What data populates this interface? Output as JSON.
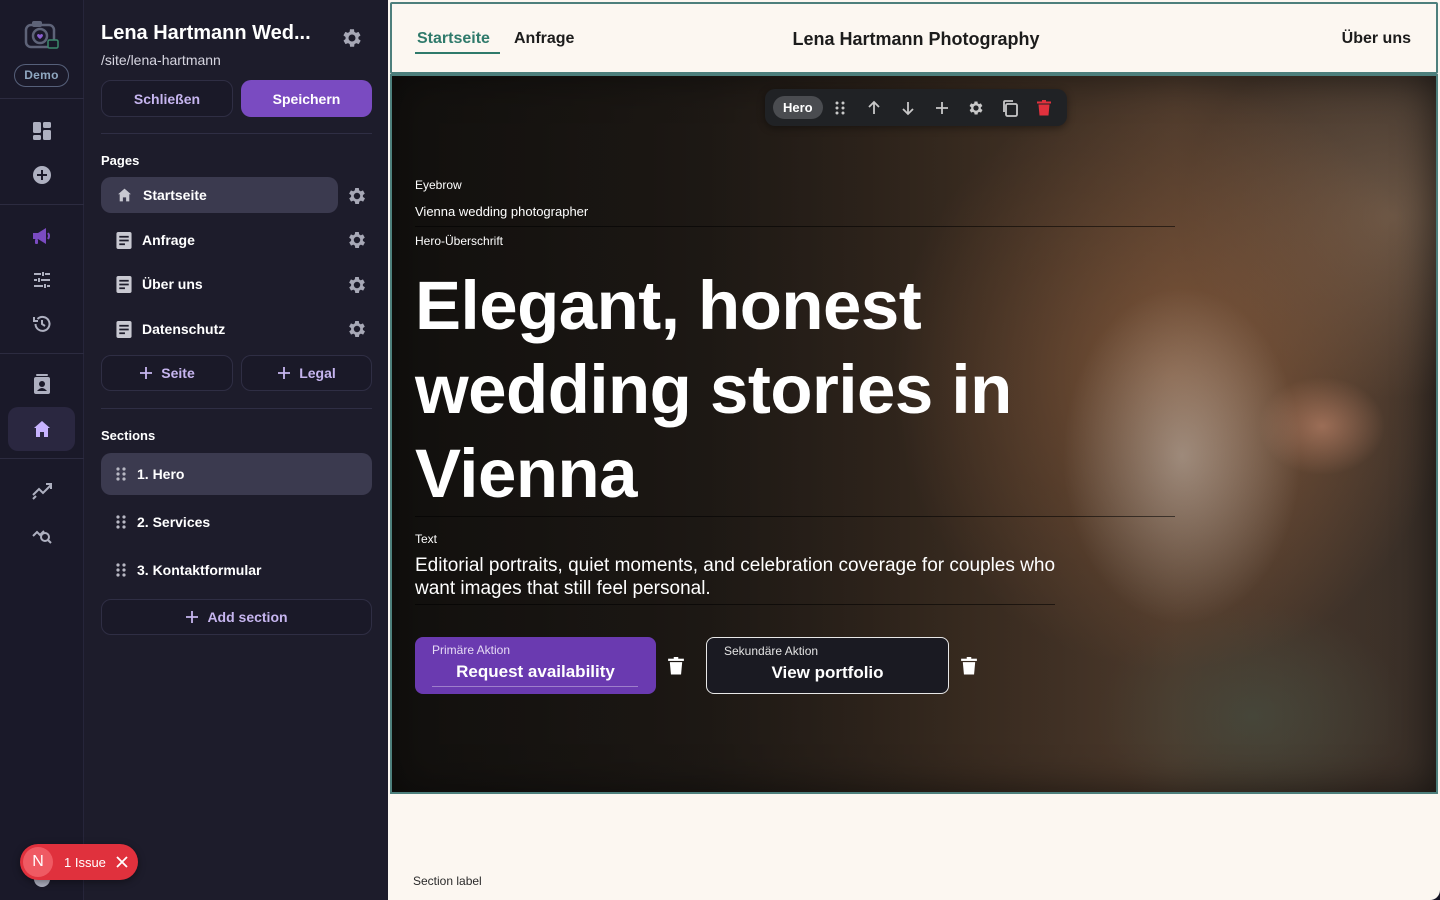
{
  "rail": {
    "demo_badge": "Demo",
    "icons": [
      "camera-logo-icon",
      "dashboard-icon",
      "add-circle-icon",
      "megaphone-icon",
      "sliders-icon",
      "history-icon",
      "contact-card-icon",
      "home-icon",
      "analytics-icon",
      "search-analytics-icon"
    ]
  },
  "sidebar": {
    "site_title": "Lena Hartmann Wed...",
    "site_path": "/site/lena-hartmann",
    "close_label": "Schließen",
    "save_label": "Speichern",
    "pages_heading": "Pages",
    "pages": [
      {
        "label": "Startseite",
        "icon": "home-icon"
      },
      {
        "label": "Anfrage",
        "icon": "document-icon"
      },
      {
        "label": "Über uns",
        "icon": "document-icon"
      },
      {
        "label": "Datenschutz",
        "icon": "document-icon"
      }
    ],
    "add_page_label": "Seite",
    "add_legal_label": "Legal",
    "sections_heading": "Sections",
    "sections": [
      {
        "label": "1. Hero"
      },
      {
        "label": "2. Services"
      },
      {
        "label": "3. Kontaktformular"
      }
    ],
    "add_section_label": "Add section"
  },
  "issue": {
    "avatar_letter": "N",
    "text": "1 Issue"
  },
  "preview": {
    "nav": {
      "links_left": [
        "Startseite",
        "Anfrage"
      ],
      "brand": "Lena Hartmann Photography",
      "link_right": "Über uns"
    },
    "toolbar": {
      "badge": "Hero"
    },
    "hero": {
      "eyebrow_field_label": "Eyebrow",
      "eyebrow": "Vienna wedding photographer",
      "headline_field_label": "Hero-Überschrift",
      "headline": "Elegant, honest wedding stories in Vienna",
      "text_field_label": "Text",
      "text": "Editorial portraits, quiet moments, and celebration coverage for couples who want images that still feel personal.",
      "primary_field_label": "Primäre Aktion",
      "primary_cta": "Request availability",
      "secondary_field_label": "Sekundäre Aktion",
      "secondary_cta": "View portfolio"
    },
    "next_section_label": "Section label"
  },
  "colors": {
    "accent": "#7a4bc1",
    "nav_active": "#2f7a6b",
    "danger": "#e0313d"
  }
}
